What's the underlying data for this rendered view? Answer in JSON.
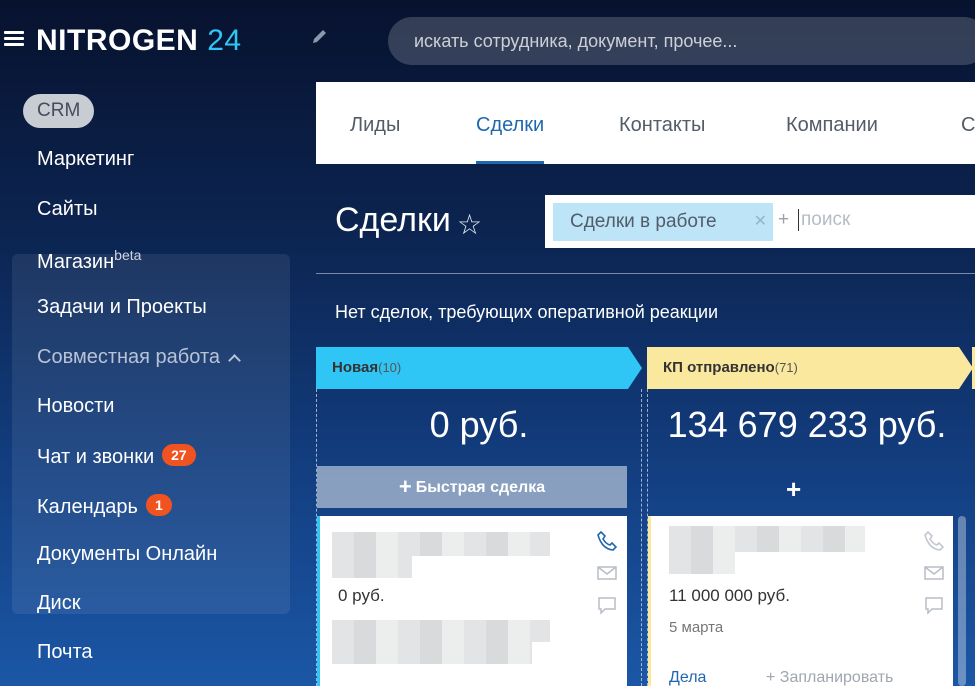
{
  "header": {
    "logo_text": "NITROGEN",
    "logo_number": "24",
    "search_placeholder": "искать сотрудника, документ, прочее..."
  },
  "sidebar": {
    "crm": "CRM",
    "items": [
      {
        "label": "Маркетинг"
      },
      {
        "label": "Сайты"
      },
      {
        "label": "Магазин",
        "sup": "beta"
      },
      {
        "label": "Задачи и Проекты"
      }
    ],
    "group": {
      "title": "Совместная работа",
      "items": [
        {
          "label": "Новости"
        },
        {
          "label": "Чат и звонки",
          "badge": "27"
        },
        {
          "label": "Календарь",
          "badge": "1"
        },
        {
          "label": "Документы Онлайн"
        },
        {
          "label": "Диск"
        },
        {
          "label": "Почта"
        }
      ]
    }
  },
  "tabs": [
    {
      "label": "Лиды"
    },
    {
      "label": "Сделки",
      "active": true
    },
    {
      "label": "Контакты"
    },
    {
      "label": "Компании"
    },
    {
      "label": "С"
    }
  ],
  "page": {
    "title": "Сделки",
    "filter_chip": "Сделки в работе",
    "filter_add": "+",
    "filter_placeholder": "поиск",
    "notice": "Нет сделок, требующих оперативной реакции"
  },
  "columns": [
    {
      "name": "Новая",
      "count": "(10)",
      "sum": "0 руб.",
      "quick_add": "Быстрая сделка",
      "card": {
        "sum": "0 руб."
      }
    },
    {
      "name": "КП отправлено",
      "count": "(71)",
      "sum": "134 679 233 руб.",
      "card": {
        "sum": "11 000 000 руб.",
        "date": "5 марта",
        "link": "Дела",
        "plan": "+ Запланировать"
      }
    }
  ],
  "colors": {
    "accent": "#2fc6f6",
    "column_new": "#2fc6f6",
    "column_kp": "#fbe89f",
    "tab_active": "#2067b0",
    "badge": "#f0531f"
  }
}
